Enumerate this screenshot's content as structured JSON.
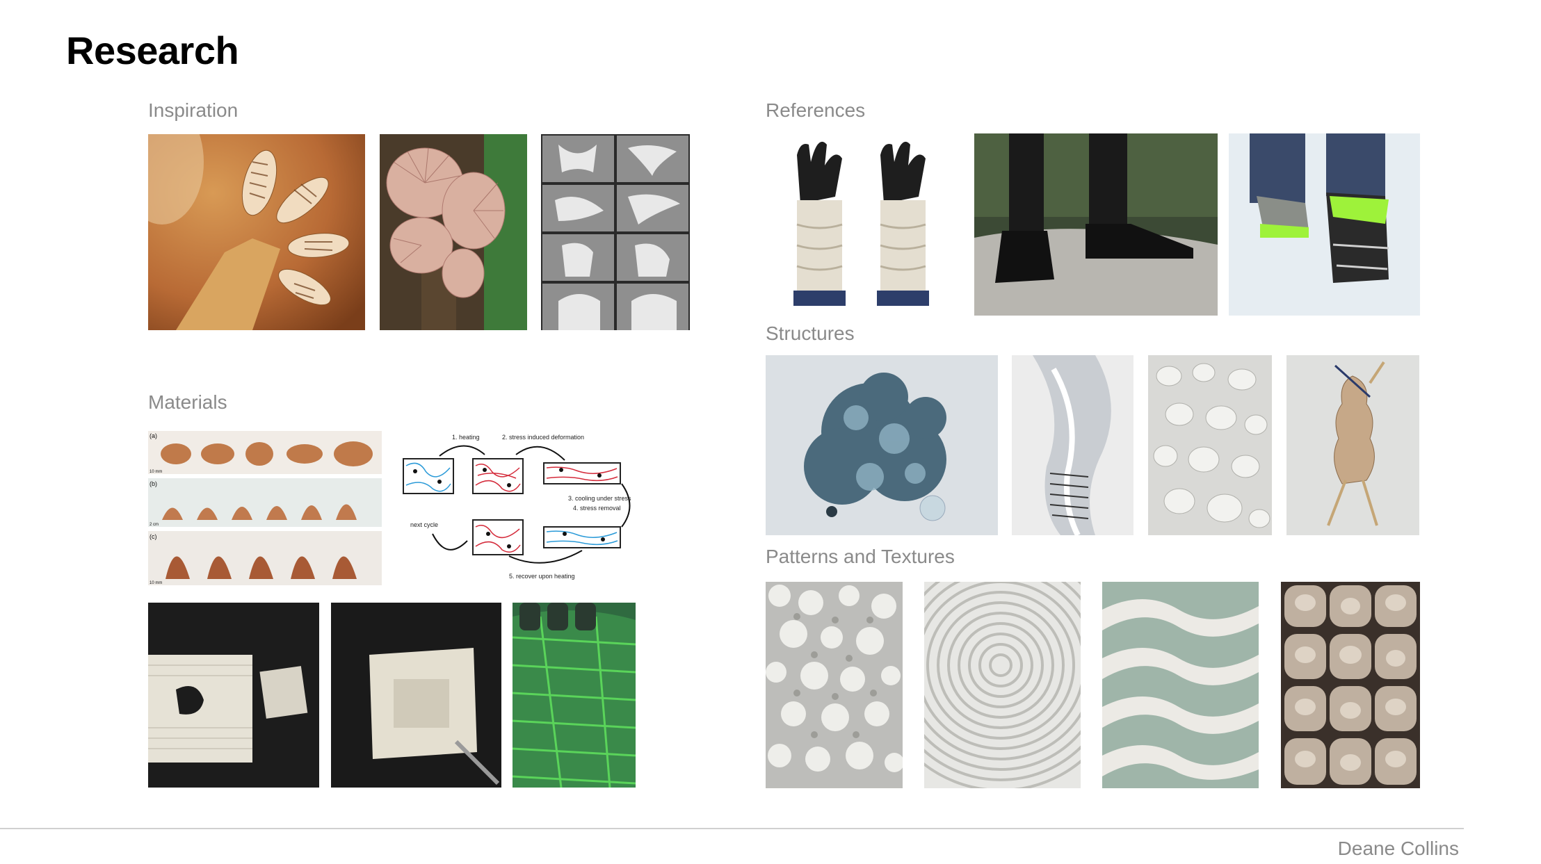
{
  "page": {
    "title": "Research",
    "author": "Deane Collins"
  },
  "sections": {
    "inspiration": {
      "label": "Inspiration"
    },
    "references": {
      "label": "References"
    },
    "materials": {
      "label": "Materials"
    },
    "structures": {
      "label": "Structures"
    },
    "patterns": {
      "label": "Patterns and Textures"
    }
  },
  "materials_figure": {
    "panel_labels": [
      "(a)",
      "(b)",
      "(c)"
    ],
    "scale_labels": [
      "10 mm",
      "2 cm",
      "10 mm"
    ]
  },
  "shape_memory_diagram": {
    "step1": "1. heating",
    "step2": "2. stress induced deformation",
    "step3": "3. cooling under stress",
    "step4": "4. stress removal",
    "step5": "5. recover upon heating",
    "next": "next cycle"
  }
}
